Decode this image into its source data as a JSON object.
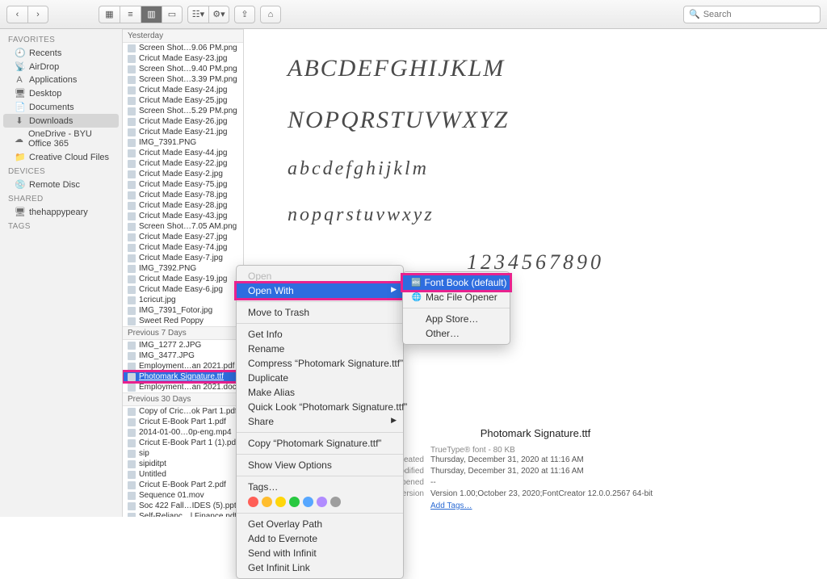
{
  "toolbar": {
    "search_placeholder": "Search"
  },
  "sidebar": {
    "sections": [
      {
        "label": "Favorites",
        "items": [
          {
            "icon": "🕘",
            "label": "Recents"
          },
          {
            "icon": "📡",
            "label": "AirDrop"
          },
          {
            "icon": "A",
            "label": "Applications"
          },
          {
            "icon": "🖥",
            "label": "Desktop"
          },
          {
            "icon": "📄",
            "label": "Documents"
          },
          {
            "icon": "⬇",
            "label": "Downloads",
            "selected": true
          },
          {
            "icon": "☁",
            "label": "OneDrive - BYU Office 365"
          },
          {
            "icon": "📁",
            "label": "Creative Cloud Files"
          }
        ]
      },
      {
        "label": "Devices",
        "items": [
          {
            "icon": "💿",
            "label": "Remote Disc"
          }
        ]
      },
      {
        "label": "Shared",
        "items": [
          {
            "icon": "🖥",
            "label": "thehappypeary"
          }
        ]
      },
      {
        "label": "Tags",
        "items": []
      }
    ]
  },
  "fileGroups": [
    {
      "label": "Yesterday",
      "items": [
        "Screen Shot…9.06 PM.png",
        "Cricut Made Easy-23.jpg",
        "Screen Shot…9.40 PM.png",
        "Screen Shot…3.39 PM.png",
        "Cricut Made Easy-24.jpg",
        "Cricut Made Easy-25.jpg",
        "Screen Shot…5.29 PM.png",
        "Cricut Made Easy-26.jpg",
        "Cricut Made Easy-21.jpg",
        "IMG_7391.PNG",
        "Cricut Made Easy-44.jpg",
        "Cricut Made Easy-22.jpg",
        "Cricut Made Easy-2.jpg",
        "Cricut Made Easy-75.jpg",
        "Cricut Made Easy-78.jpg",
        "Cricut Made Easy-28.jpg",
        "Cricut Made Easy-43.jpg",
        "Screen Shot…7.05 AM.png",
        "Cricut Made Easy-27.jpg",
        "Cricut Made Easy-74.jpg",
        "Cricut Made Easy-7.jpg",
        "IMG_7392.PNG",
        "Cricut Made Easy-19.jpg",
        "Cricut Made Easy-6.jpg",
        "1cricut.jpg",
        "IMG_7391_Fotor.jpg",
        "Sweet Red Poppy"
      ]
    },
    {
      "label": "Previous 7 Days",
      "items": [
        "IMG_1277 2.JPG",
        "IMG_3477.JPG",
        "Employment…an 2021.pdf",
        "Photomark Signature.ttf",
        "Employment…an 2021.docx"
      ],
      "selected_index": 3,
      "highlight_index": 3
    },
    {
      "label": "Previous 30 Days",
      "items": [
        "Copy of Cric…ok Part 1.pdf",
        "Cricut E-Book Part 1.pdf",
        "2014-01-00…0p-eng.mp4",
        "Cricut E-Book Part 1 (1).pdf",
        "sip",
        "sipiditpt",
        "Untitled",
        "Cricut E-Book Part 2.pdf",
        "Sequence 01.mov",
        "Soc 422 Fall…IDES (5).pptx",
        "Self-Relianc…l Finance.pdf"
      ]
    }
  ],
  "contextMenu": {
    "groups": [
      [
        "Open",
        "Open With"
      ],
      [
        "Move to Trash"
      ],
      [
        "Get Info",
        "Rename",
        "Compress “Photomark Signature.ttf”",
        "Duplicate",
        "Make Alias",
        "Quick Look “Photomark Signature.ttf”",
        "Share"
      ],
      [
        "Copy “Photomark Signature.ttf”"
      ],
      [
        "Show View Options"
      ],
      [
        "Tags…"
      ],
      [
        "Get Overlay Path",
        "Add to Evernote",
        "Send with Infinit",
        "Get Infinit Link"
      ]
    ],
    "hovered": "Open With",
    "disabled": [
      "Open"
    ],
    "arrows": [
      "Open With",
      "Share"
    ]
  },
  "submenu": {
    "items": [
      {
        "label": "Font Book (default)",
        "icon": "🔤",
        "hi": true
      },
      {
        "label": "Mac File Opener",
        "icon": "🌐"
      },
      {
        "label": "App Store…"
      },
      {
        "label": "Other…"
      }
    ],
    "separator_after": 1
  },
  "tagColors": [
    "#ff5f57",
    "#ffbd2e",
    "#ffd60a",
    "#28c840",
    "#57a7ff",
    "#b18cff",
    "#9e9e9e"
  ],
  "preview": {
    "lines": [
      "ABCDEFGHIJKLM",
      "NOPQRSTUVWXYZ",
      "abcdefghijklm",
      "nopqrstuvwxyz",
      "1234567890"
    ],
    "filename": "Photomark Signature.ttf",
    "meta": {
      "kind": "TrueType® font - 80 KB",
      "rows": [
        {
          "lab": "Created",
          "val": "Thursday, December 31, 2020 at 11:16 AM"
        },
        {
          "lab": "Modified",
          "val": "Thursday, December 31, 2020 at 11:16 AM"
        },
        {
          "lab": "Last opened",
          "val": "--"
        },
        {
          "lab": "Version",
          "val": "Version 1.00;October 23, 2020;FontCreator 12.0.0.2567 64-bit"
        }
      ],
      "addtags": "Add Tags…"
    }
  }
}
